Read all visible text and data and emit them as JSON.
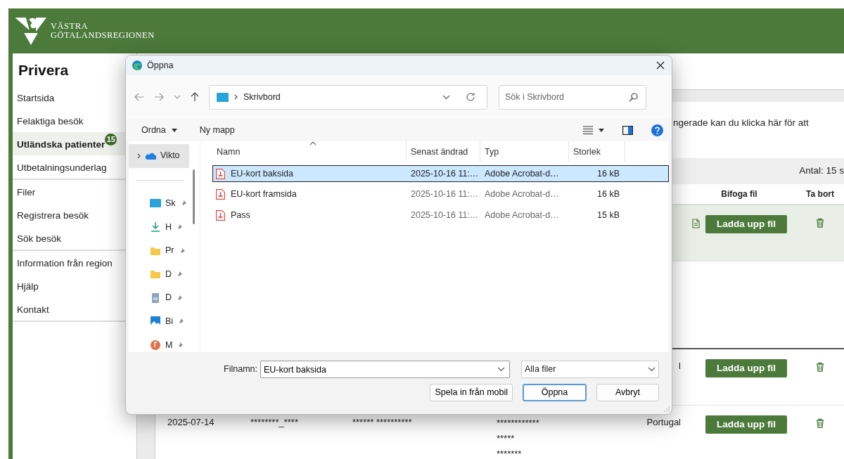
{
  "header": {
    "logo_lines": [
      "VÄSTRA",
      "GÖTALANDSREGIONEN"
    ]
  },
  "sidebar": {
    "title": "Privera",
    "groups": [
      [
        {
          "label": "Startsida",
          "selected": false
        },
        {
          "label": "Felaktiga besök",
          "selected": false
        },
        {
          "label": "Utländska patienter",
          "selected": true,
          "badge": "15"
        },
        {
          "label": "Utbetalningsunderlag",
          "selected": false
        }
      ],
      [
        {
          "label": "Filer",
          "selected": false
        },
        {
          "label": "Registrera besök",
          "selected": false
        },
        {
          "label": "Sök besök",
          "selected": false
        }
      ],
      [
        {
          "label": "Information från region",
          "selected": false
        },
        {
          "label": "Hjälp",
          "selected": false
        },
        {
          "label": "Kontakt",
          "selected": false
        }
      ]
    ]
  },
  "main": {
    "info_text": "ngerade kan du klicka här för att",
    "count": "Antal: 15 s",
    "columns": [
      "Bifoga fil",
      "Ta bort"
    ],
    "rows": [
      {
        "selected": true,
        "has_file": true,
        "upload_button": "Ladda upp fil"
      },
      {
        "selected": false,
        "has_file": false,
        "column_5": "l",
        "upload_button": "Ladda upp fil"
      },
      {
        "selected": false,
        "has_file": false,
        "column_1": "2025-07-14",
        "column_2": "********_****",
        "column_3": "****** **********",
        "column_4": [
          "************",
          "*****",
          "*******"
        ],
        "column_5": "Portugal",
        "upload_button": "Ladda upp fil"
      }
    ]
  },
  "dialog": {
    "title": "Öppna",
    "address": "Skrivbord",
    "search": {
      "placeholder": "Sök i Skrivbord"
    },
    "organize": "Ordna",
    "new_folder": "Ny mapp",
    "nav_pane": [
      {
        "label": "Vikto",
        "kind": "cloud",
        "selected": true,
        "pinned": false
      },
      {
        "label": "Sk",
        "kind": "desktop",
        "selected": false,
        "pinned": true
      },
      {
        "label": "H",
        "kind": "download",
        "selected": false,
        "pinned": true
      },
      {
        "label": "Pr",
        "kind": "folder",
        "selected": false,
        "pinned": true
      },
      {
        "label": "D",
        "kind": "folder",
        "selected": false,
        "pinned": true
      },
      {
        "label": "D",
        "kind": "document",
        "selected": false,
        "pinned": true
      },
      {
        "label": "Bi",
        "kind": "pictures",
        "selected": false,
        "pinned": true
      },
      {
        "label": "M",
        "kind": "music",
        "selected": false,
        "pinned": true
      }
    ],
    "columns": [
      {
        "label": "Namn",
        "sorted": true
      },
      {
        "label": "Senast ändrad",
        "sorted": false
      },
      {
        "label": "Typ",
        "sorted": false
      },
      {
        "label": "Storlek",
        "sorted": false
      }
    ],
    "files": [
      {
        "name": "EU-kort baksida",
        "modified": "2025-10-16 11:…",
        "type": "Adobe Acrobat-d…",
        "size": "16 kB",
        "selected": true
      },
      {
        "name": "EU-kort framsida",
        "modified": "2025-10-16 11:…",
        "type": "Adobe Acrobat-d…",
        "size": "16 kB",
        "selected": false
      },
      {
        "name": "Pass",
        "modified": "2025-10-16 11:…",
        "type": "Adobe Acrobat-d…",
        "size": "15 kB",
        "selected": false
      }
    ],
    "filename": {
      "label": "Filnamn:",
      "value": "EU-kort baksida"
    },
    "filter": "Alla filer",
    "buttons": [
      {
        "label": "Spela in från mobil",
        "default": false
      },
      {
        "label": "Öppna",
        "default": true
      },
      {
        "label": "Avbryt",
        "default": false
      }
    ]
  }
}
